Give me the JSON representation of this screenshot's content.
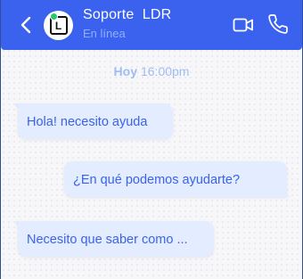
{
  "header": {
    "contact_name": "Soporte  LDR",
    "status": "En línea",
    "avatar_letter": "L",
    "back_icon": "chevron-left-icon",
    "video_icon": "video-camera-icon",
    "call_icon": "phone-icon",
    "background_color": "#3a62ee",
    "online_indicator_color": "#28c76f"
  },
  "conversation": {
    "date_separator": {
      "day": "Hoy",
      "time": "16:00pm"
    },
    "messages": [
      {
        "direction": "incoming",
        "text": "Hola! necesito ayuda"
      },
      {
        "direction": "outgoing",
        "text": "¿En qué podemos ayudarte?"
      },
      {
        "direction": "incoming",
        "text": "Necesito que saber como ..."
      }
    ],
    "bubble_color": "#e3edff",
    "text_color": "#3a62ee"
  }
}
